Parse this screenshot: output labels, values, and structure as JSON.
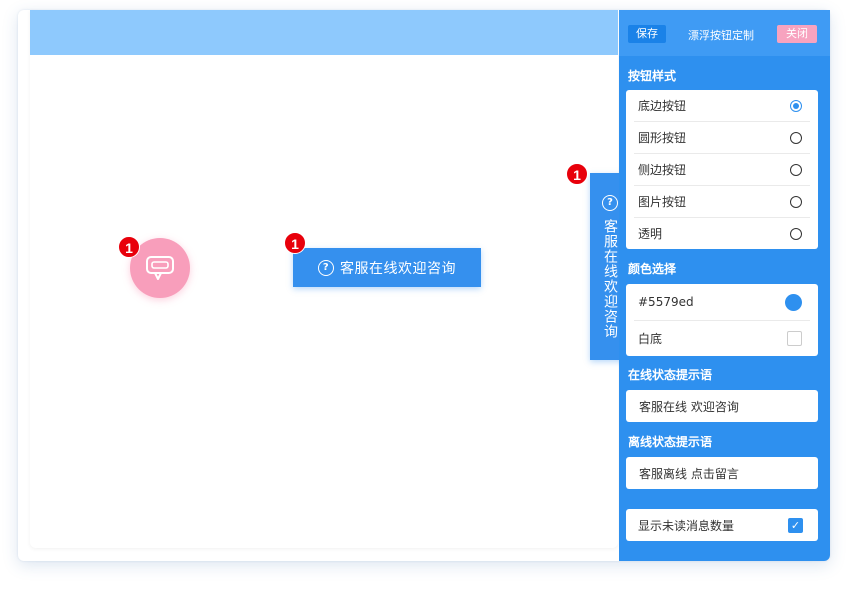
{
  "preview": {
    "badge_count": "1",
    "pill_text": "客服在线欢迎咨询",
    "side_text": "客服在线欢迎咨询"
  },
  "panel": {
    "save_label": "保存",
    "title": "漂浮按钮定制",
    "close_label": "关闭",
    "style_section": "按钮样式",
    "style_options": [
      {
        "label": "底边按钮",
        "selected": true
      },
      {
        "label": "圆形按钮",
        "selected": false
      },
      {
        "label": "侧边按钮",
        "selected": false
      },
      {
        "label": "图片按钮",
        "selected": false
      },
      {
        "label": "透明",
        "selected": false
      }
    ],
    "color_section": "颜色选择",
    "color_options": [
      {
        "label": "#5579ed",
        "color": "#2e90ef",
        "selected": true
      },
      {
        "label": "白底",
        "selected": false
      }
    ],
    "online_section": "在线状态提示语",
    "online_text": "客服在线 欢迎咨询",
    "offline_section": "离线状态提示语",
    "offline_text": "客服离线 点击留言",
    "unread_label": "显示未读消息数量",
    "unread_checked": true
  },
  "colors": {
    "accent": "#2e90ef",
    "topbar": "#8ec9fd",
    "pink": "#f89ebb",
    "badge": "#e8000b"
  }
}
